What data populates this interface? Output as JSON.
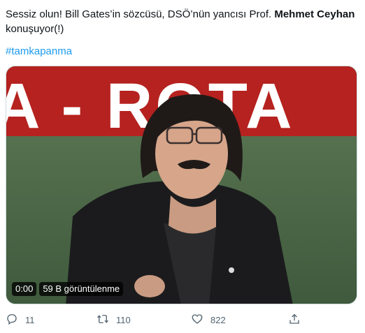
{
  "tweet": {
    "text_part1": "Sessiz olun! Bill Gates’in sözcüsü, DSÖ’nün yancısı Prof. ",
    "text_bold": "Mehmet Ceyhan",
    "text_part2": " konuşuyor(!)",
    "hashtag": "#tamkapanma"
  },
  "video": {
    "banner_text": "A - ROTA",
    "time": "0:00",
    "views": "59 B görüntülenme"
  },
  "actions": {
    "replies": "11",
    "retweets": "110",
    "likes": "822"
  },
  "icons": [
    "reply-icon",
    "retweet-icon",
    "like-icon",
    "share-icon"
  ],
  "colors": {
    "hashtag": "#1d9bf0",
    "text": "#0f1419",
    "secondary": "#536471",
    "banner_red": "#b5221f"
  }
}
